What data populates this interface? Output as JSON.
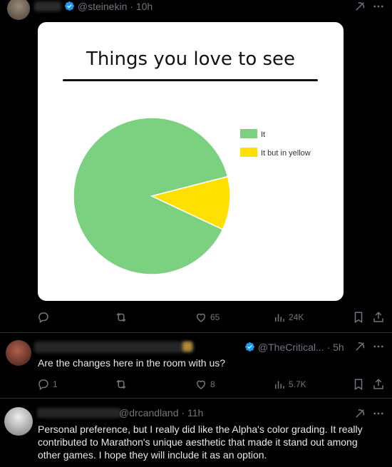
{
  "post1": {
    "handle": "@steinekin",
    "time": "10h",
    "card": {
      "title": "Things you love to see"
    },
    "actions": {
      "replies": "",
      "reposts": "",
      "likes": "65",
      "views": "24K"
    }
  },
  "post2": {
    "handle": "@TheCritical...",
    "time": "5h",
    "text": "Are the changes here in the room with us?",
    "actions": {
      "replies": "1",
      "reposts": "",
      "likes": "8",
      "views": "5.7K"
    }
  },
  "post3": {
    "handle": "@drcandland",
    "time": "11h",
    "text_lines": [
      "Personal preference, but I really did like the Alpha's color grading. It really",
      "contributed to Marathon's  unique aesthetic that made it stand out among",
      "other games. I hope they will include it as an option."
    ]
  },
  "chart_data": {
    "type": "pie",
    "title": "Things you love to see",
    "series": [
      {
        "name": "It",
        "value": 89,
        "color": "#7bd17f"
      },
      {
        "name": "It but in yellow",
        "value": 11,
        "color": "#ffe000"
      }
    ],
    "legend_position": "top-right"
  },
  "colors": {
    "background": "#000000",
    "text": "#e7e9ea",
    "muted": "#71767b",
    "verified": "#1d9bf0"
  },
  "icons": [
    "verified-icon",
    "grok-icon",
    "more-icon",
    "reply-icon",
    "repost-icon",
    "like-icon",
    "views-icon",
    "bookmark-icon",
    "share-icon"
  ]
}
